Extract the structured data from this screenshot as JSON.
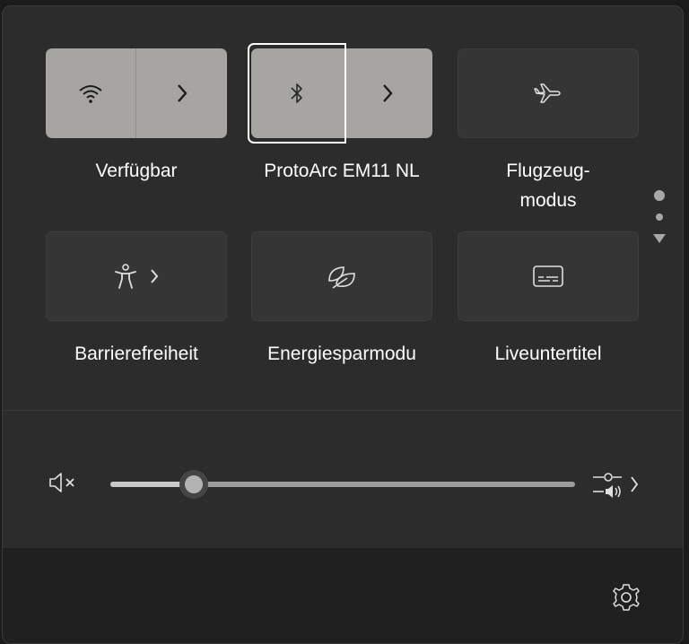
{
  "quick_settings": {
    "tiles": [
      {
        "label": "Verfügbar",
        "icon": "wifi-icon",
        "state": "on",
        "expandable": true
      },
      {
        "label": "ProtoArc EM11 NL",
        "icon": "bluetooth-icon",
        "state": "on",
        "expandable": true,
        "focused": true
      },
      {
        "label": "Flugzeug-\nmodus",
        "icon": "airplane-icon",
        "state": "off",
        "expandable": false
      },
      {
        "label": "Barrierefreiheit",
        "icon": "accessibility-icon",
        "state": "off",
        "expandable": true
      },
      {
        "label": "Energiesparmodu",
        "icon": "leaf-icon",
        "state": "off",
        "expandable": false
      },
      {
        "label": "Liveuntertitel",
        "icon": "captions-icon",
        "state": "off",
        "expandable": false
      }
    ],
    "page_indicator": {
      "pages": 2,
      "current": 1
    }
  },
  "volume": {
    "level": 0.18,
    "muted": true,
    "mute_icon": "speaker-muted-icon",
    "output_icon": "audio-output-icon"
  },
  "footer": {
    "settings_icon": "gear-icon"
  },
  "colors": {
    "panel_bg": "#2c2c2c",
    "tile_on": "#a6a5a1",
    "tile_off": "#353535",
    "footer_bg": "#202020"
  }
}
